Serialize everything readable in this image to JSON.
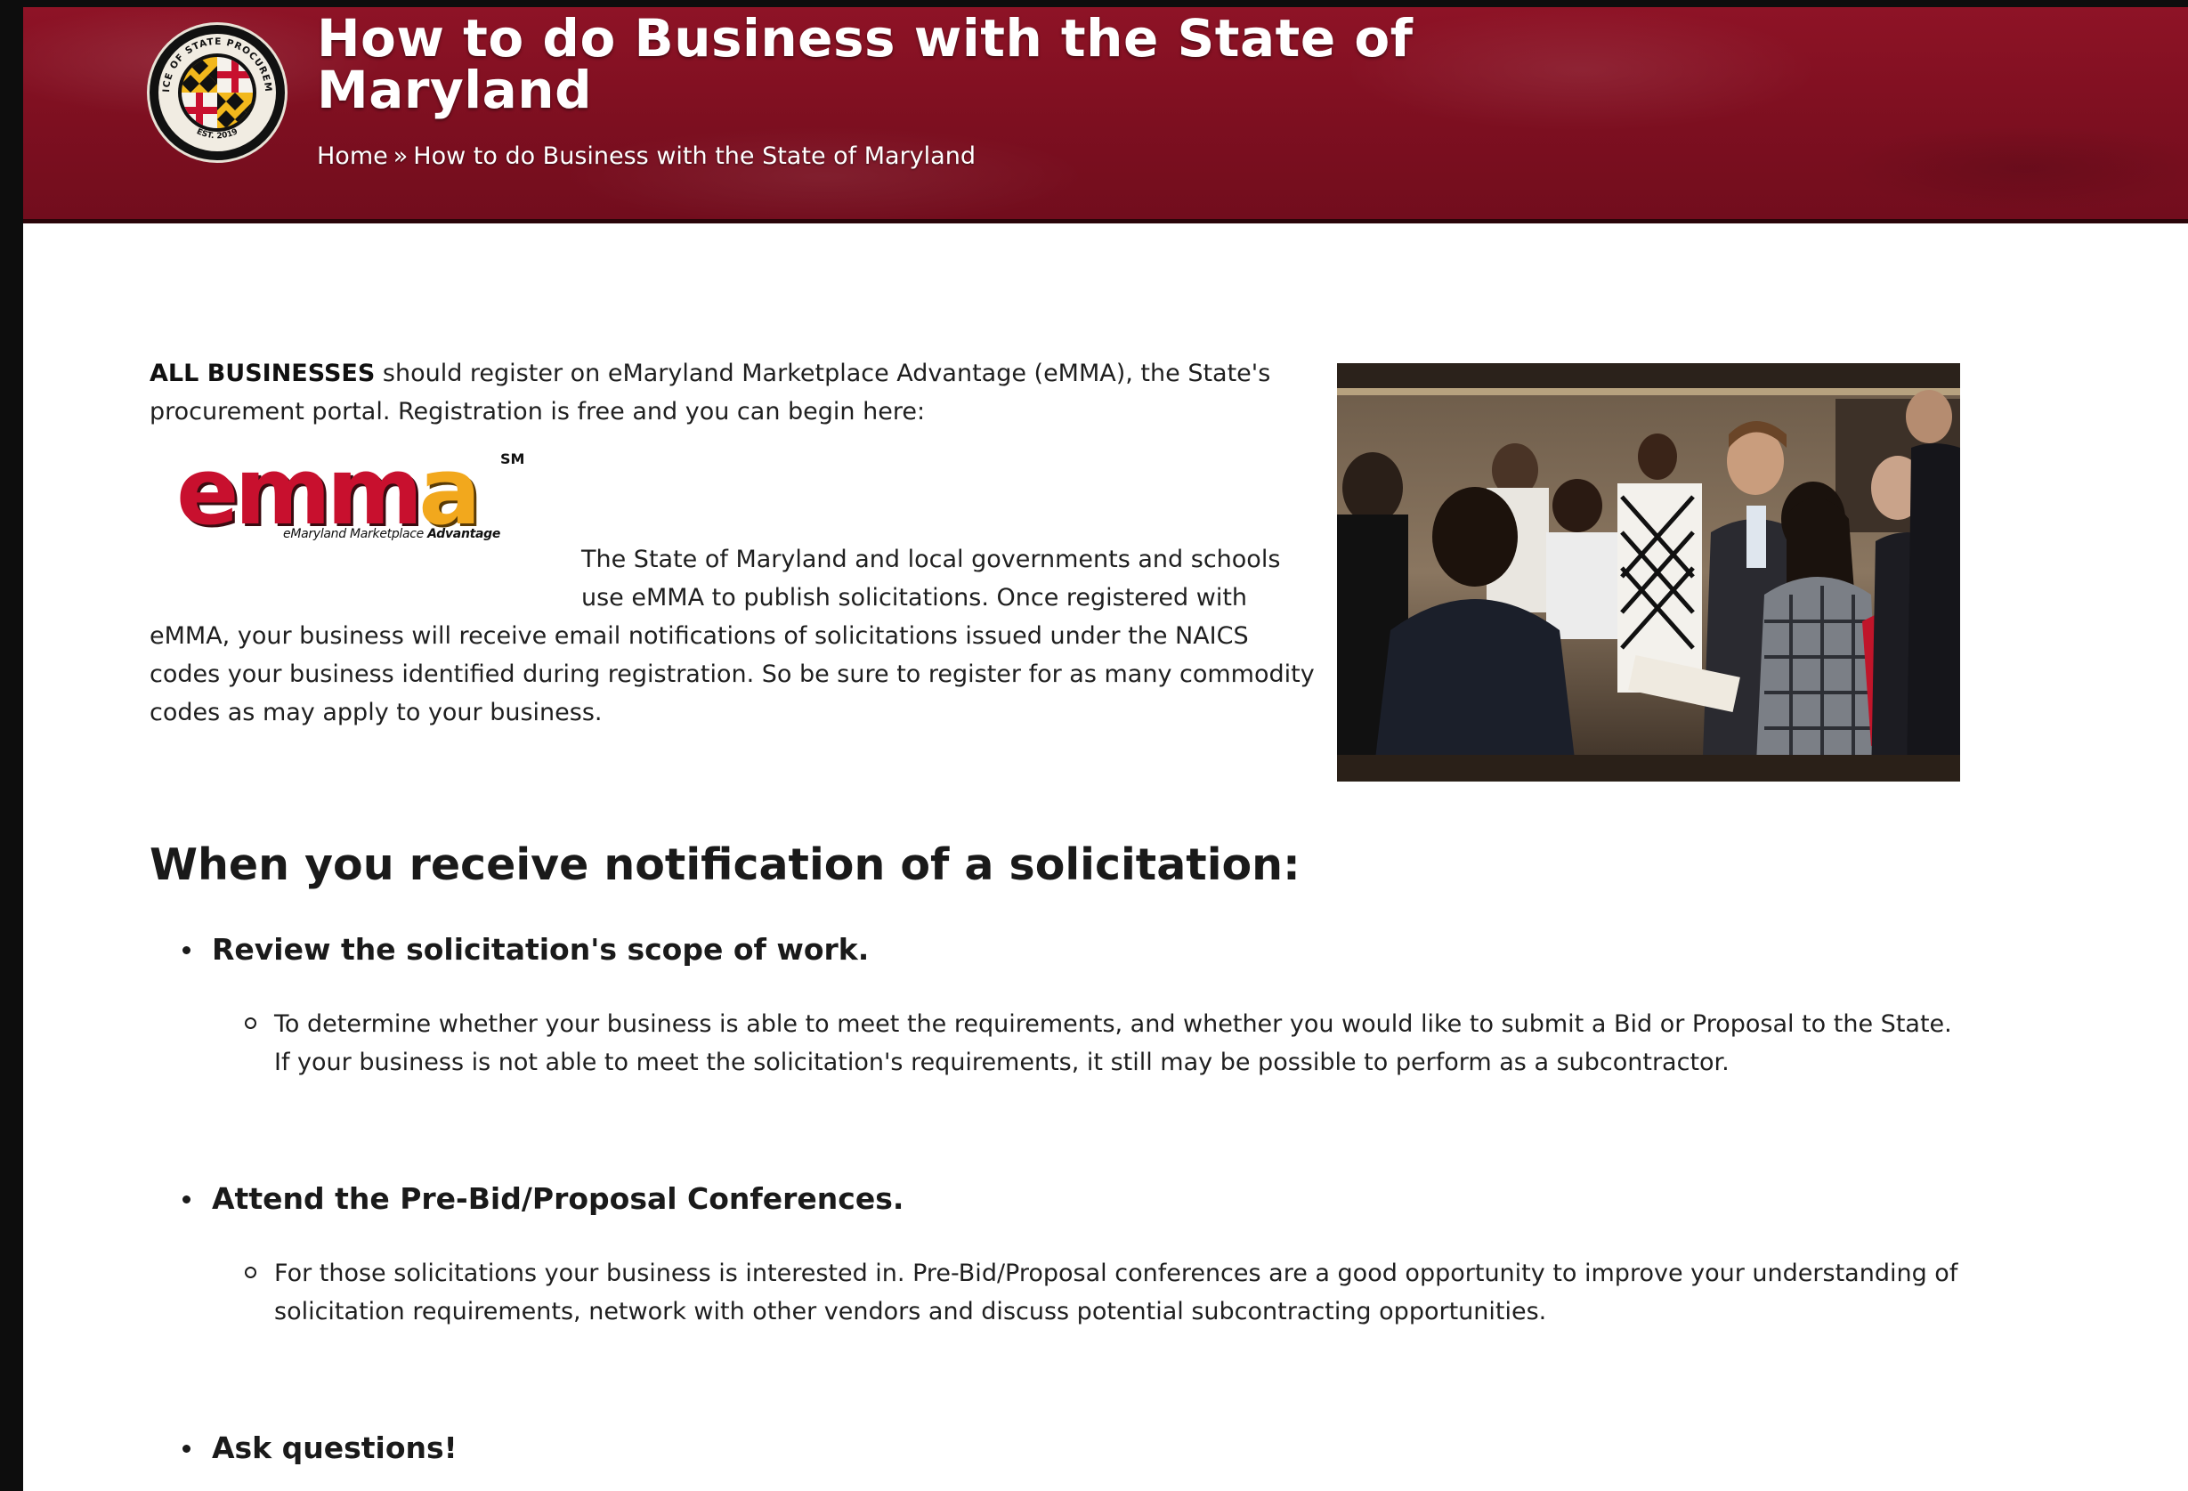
{
  "header": {
    "title": "How to do Business with the State of Maryland",
    "breadcrumb": {
      "home": "Home",
      "separator": "»",
      "current": "How to do Business with the State of Maryland"
    },
    "seal": {
      "top_text": "OFFICE OF STATE PROCUREMENT",
      "bottom_text": "EST. 2019"
    },
    "colors": {
      "banner": "#7d0f20",
      "banner_dark": "#2a0509"
    }
  },
  "intro": {
    "bold_lead": "ALL BUSINESSES",
    "text": " should register on eMaryland Marketplace Advantage (eMMA), the State's procurement portal. Registration is free and you can begin here:"
  },
  "emma_logo": {
    "word_main": "emm",
    "word_accent": "a",
    "service_mark": "SM",
    "tagline_plain": "eMaryland Marketplace ",
    "tagline_emphasis": "Advantage",
    "colors": {
      "red": "#c8102e",
      "gold": "#f2a81d"
    }
  },
  "body_paragraph": "The State of Maryland and local governments and schools use eMMA to publish solicitations. Once registered with eMMA, your business will receive email notifications of solicitations issued under the NAICS codes your business identified during registration. So be sure to register for as many commodity codes as may apply to your business.",
  "section_heading": "When you receive notification of a solicitation:",
  "steps": [
    {
      "title": "Review the solicitation's scope of work.",
      "detail": "To determine whether your business is able to meet the requirements, and whether you would like to submit a Bid or Proposal to the State. If your business is not able to meet the solicitation's requirements, it still may be possible to perform as a subcontractor."
    },
    {
      "title": "Attend the Pre-Bid/Proposal Conferences.",
      "detail": "For those solicitations your business is interested in. Pre-Bid/Proposal conferences are a good opportunity to improve your understanding of solicitation requirements, network with other vendors and discuss potential subcontracting opportunities."
    },
    {
      "title": "Ask questions!"
    }
  ]
}
